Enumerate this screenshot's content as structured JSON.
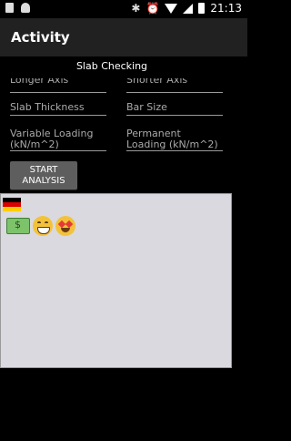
{
  "status_bar": {
    "time": "21:13",
    "icons": [
      "document-icon",
      "android-icon",
      "bluetooth-icon",
      "alarm-icon",
      "wifi-icon",
      "signal-icon",
      "battery-icon"
    ]
  },
  "app_bar": {
    "title": "Activity"
  },
  "screen": {
    "subtitle": "Slab Checking"
  },
  "form": {
    "longer_axis_placeholder": "Longer Axis",
    "shorter_axis_placeholder": "Shorter Axis",
    "slab_thickness_placeholder": "Slab Thickness",
    "bar_size_placeholder": "Bar Size",
    "variable_loading_placeholder": "Variable Loading (kN/m^2)",
    "permanent_loading_placeholder": "Permanent Loading (kN/m^2)"
  },
  "buttons": {
    "start_analysis": "START ANALYSIS"
  },
  "output": {
    "emojis": [
      "germany-flag",
      "money-bill",
      "grinning-face",
      "heart-eyes-face"
    ]
  },
  "colors": {
    "background": "#000000",
    "app_bar": "#212121",
    "button": "#5e5e5e",
    "output_panel": "#d9d9df",
    "field_text": "#aaaaaa"
  }
}
